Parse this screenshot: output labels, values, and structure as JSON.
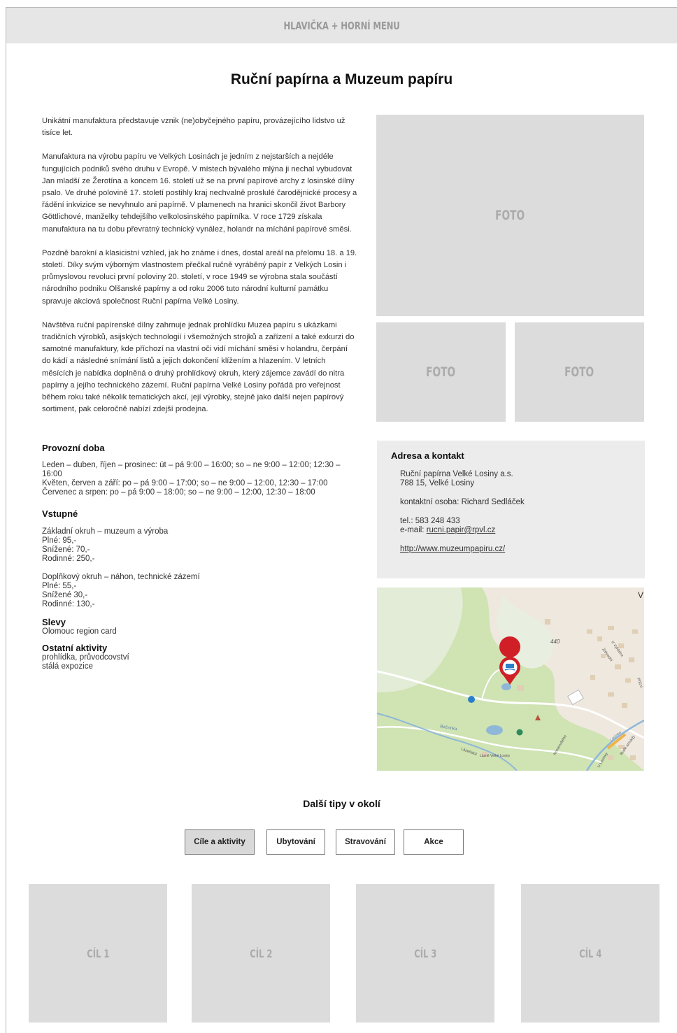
{
  "header": {
    "label": "HLAVIČKA + HORNÍ MENU"
  },
  "title": "Ruční papírna a Muzeum papíru",
  "intro": [
    "Unikátní manufaktura představuje vznik (ne)obyčejného papíru, provázejícího lidstvo už tisíce let.",
    "Manufaktura na výrobu papíru ve Velkých Losinách je jedním z nejstarších a nejdéle fungujících podniků svého druhu v Evropě. V místech bývalého mlýna ji nechal vybudovat Jan mladší ze Žerotína a koncem 16. století už se na první papírové archy z losinské dílny psalo. Ve druhé polovině 17. století postihly kraj nechvalně proslulé čarodějnické procesy a řádění inkvizice se nevyhnulo ani papírně. V plamenech na hranici skončil život Barbory Göttlichové, manželky tehdejšího velkolosinského papírníka. V roce 1729 získala manufaktura na tu dobu převratný technický vynález, holandr na míchání papírové směsi.",
    "Pozdně barokní a klasicistní vzhled, jak ho známe i dnes, dostal areál na přelomu 18. a 19. století. Díky svým výborným vlastnostem přečkal ručně vyráběný papír z Velkých Losin i průmyslovou revoluci první poloviny 20. století, v roce 1949 se výrobna stala součástí národního podniku Olšanské papírny a od roku 2006 tuto národní kulturní památku spravuje akciová společnost Ruční papírna Velké Losiny.",
    "Návštěva ruční papírenské dílny zahrnuje jednak prohlídku Muzea papíru s ukázkami tradičních výrobků, asijských technologií i všemožných strojků a zařízení a také exkurzi do samotné manufaktury, kde příchozí na vlastní oči vidí míchání směsi v holandru, čerpání do kádí a následné snímání listů a jejich dokončení klížením a hlazením. V letních měsících je nabídka doplněná o druhý prohlídkový okruh, který zájemce zavádí do nitra papírny a jejího technického zázemí. Ruční papírna Velké Losiny pořádá pro veřejnost během roku také několik tematických akcí, její výrobky, stejně jako další nejen papírový sortiment, pak celoročně nabízí zdejší prodejna."
  ],
  "photos": {
    "main": "FOTO",
    "left": "FOTO",
    "right": "FOTO"
  },
  "hours": {
    "title": "Provozní doba",
    "lines": [
      "Leden – duben, říjen – prosinec: út – pá 9:00 – 16:00; so – ne 9:00 – 12:00; 12:30 – 16:00",
      "Květen, červen a září: po – pá 9:00 – 17:00; so – ne 9:00 – 12:00, 12:30 – 17:00",
      "Červenec a srpen: po – pá 9:00 – 18:00; so – ne 9:00 – 12:00, 12:30 – 18:00"
    ]
  },
  "admission": {
    "title": "Vstupné",
    "groups": [
      [
        "Základní okruh – muzeum a výroba",
        "Plné: 95,-",
        "Snížené: 70,-",
        "Rodinné: 250,-"
      ],
      [
        "Doplňkový okruh – náhon, technické zázemí",
        "Plné: 55,-",
        "Snížené 30,-",
        "Rodinné: 130,-"
      ]
    ]
  },
  "discounts": {
    "title": "Slevy",
    "lines": [
      "Olomouc region card"
    ]
  },
  "other": {
    "title": "Ostatní aktivity",
    "lines": [
      "prohlídka, průvodcovství",
      "stálá expozice"
    ]
  },
  "contact": {
    "title": "Adresa a kontakt",
    "company": "Ruční papírna Velké Losiny a.s.",
    "address": "788 15, Velké Losiny",
    "person": "kontaktní osoba: Richard Sedláček",
    "phone": "tel.: 583 248 433",
    "email_prefix": "e-mail: ",
    "email": "rucni.papir@rpvl.cz",
    "web": "http://www.muzeumpapiru.cz/"
  },
  "map": {
    "elevation": "440",
    "corner_letter": "V",
    "labels": [
      "Bečvinka",
      "Lázeňská",
      "Lázně Velké Losiny",
      "Komenského",
      "U Losinky",
      "Rudé armády",
      "Příční",
      "K Vyhlídce",
      "Zahradní",
      "Losinka"
    ],
    "colors": {
      "forest": "#cfe3b3",
      "water": "#8fb7d8",
      "marker": "#d01f26"
    }
  },
  "tips": {
    "title": "Další tipy v okolí",
    "tabs": [
      "Cíle a aktivity",
      "Ubytování",
      "Stravování",
      "Akce"
    ],
    "cards": [
      "CÍL 1",
      "CÍL 2",
      "CÍL 3",
      "CÍL 4"
    ]
  }
}
